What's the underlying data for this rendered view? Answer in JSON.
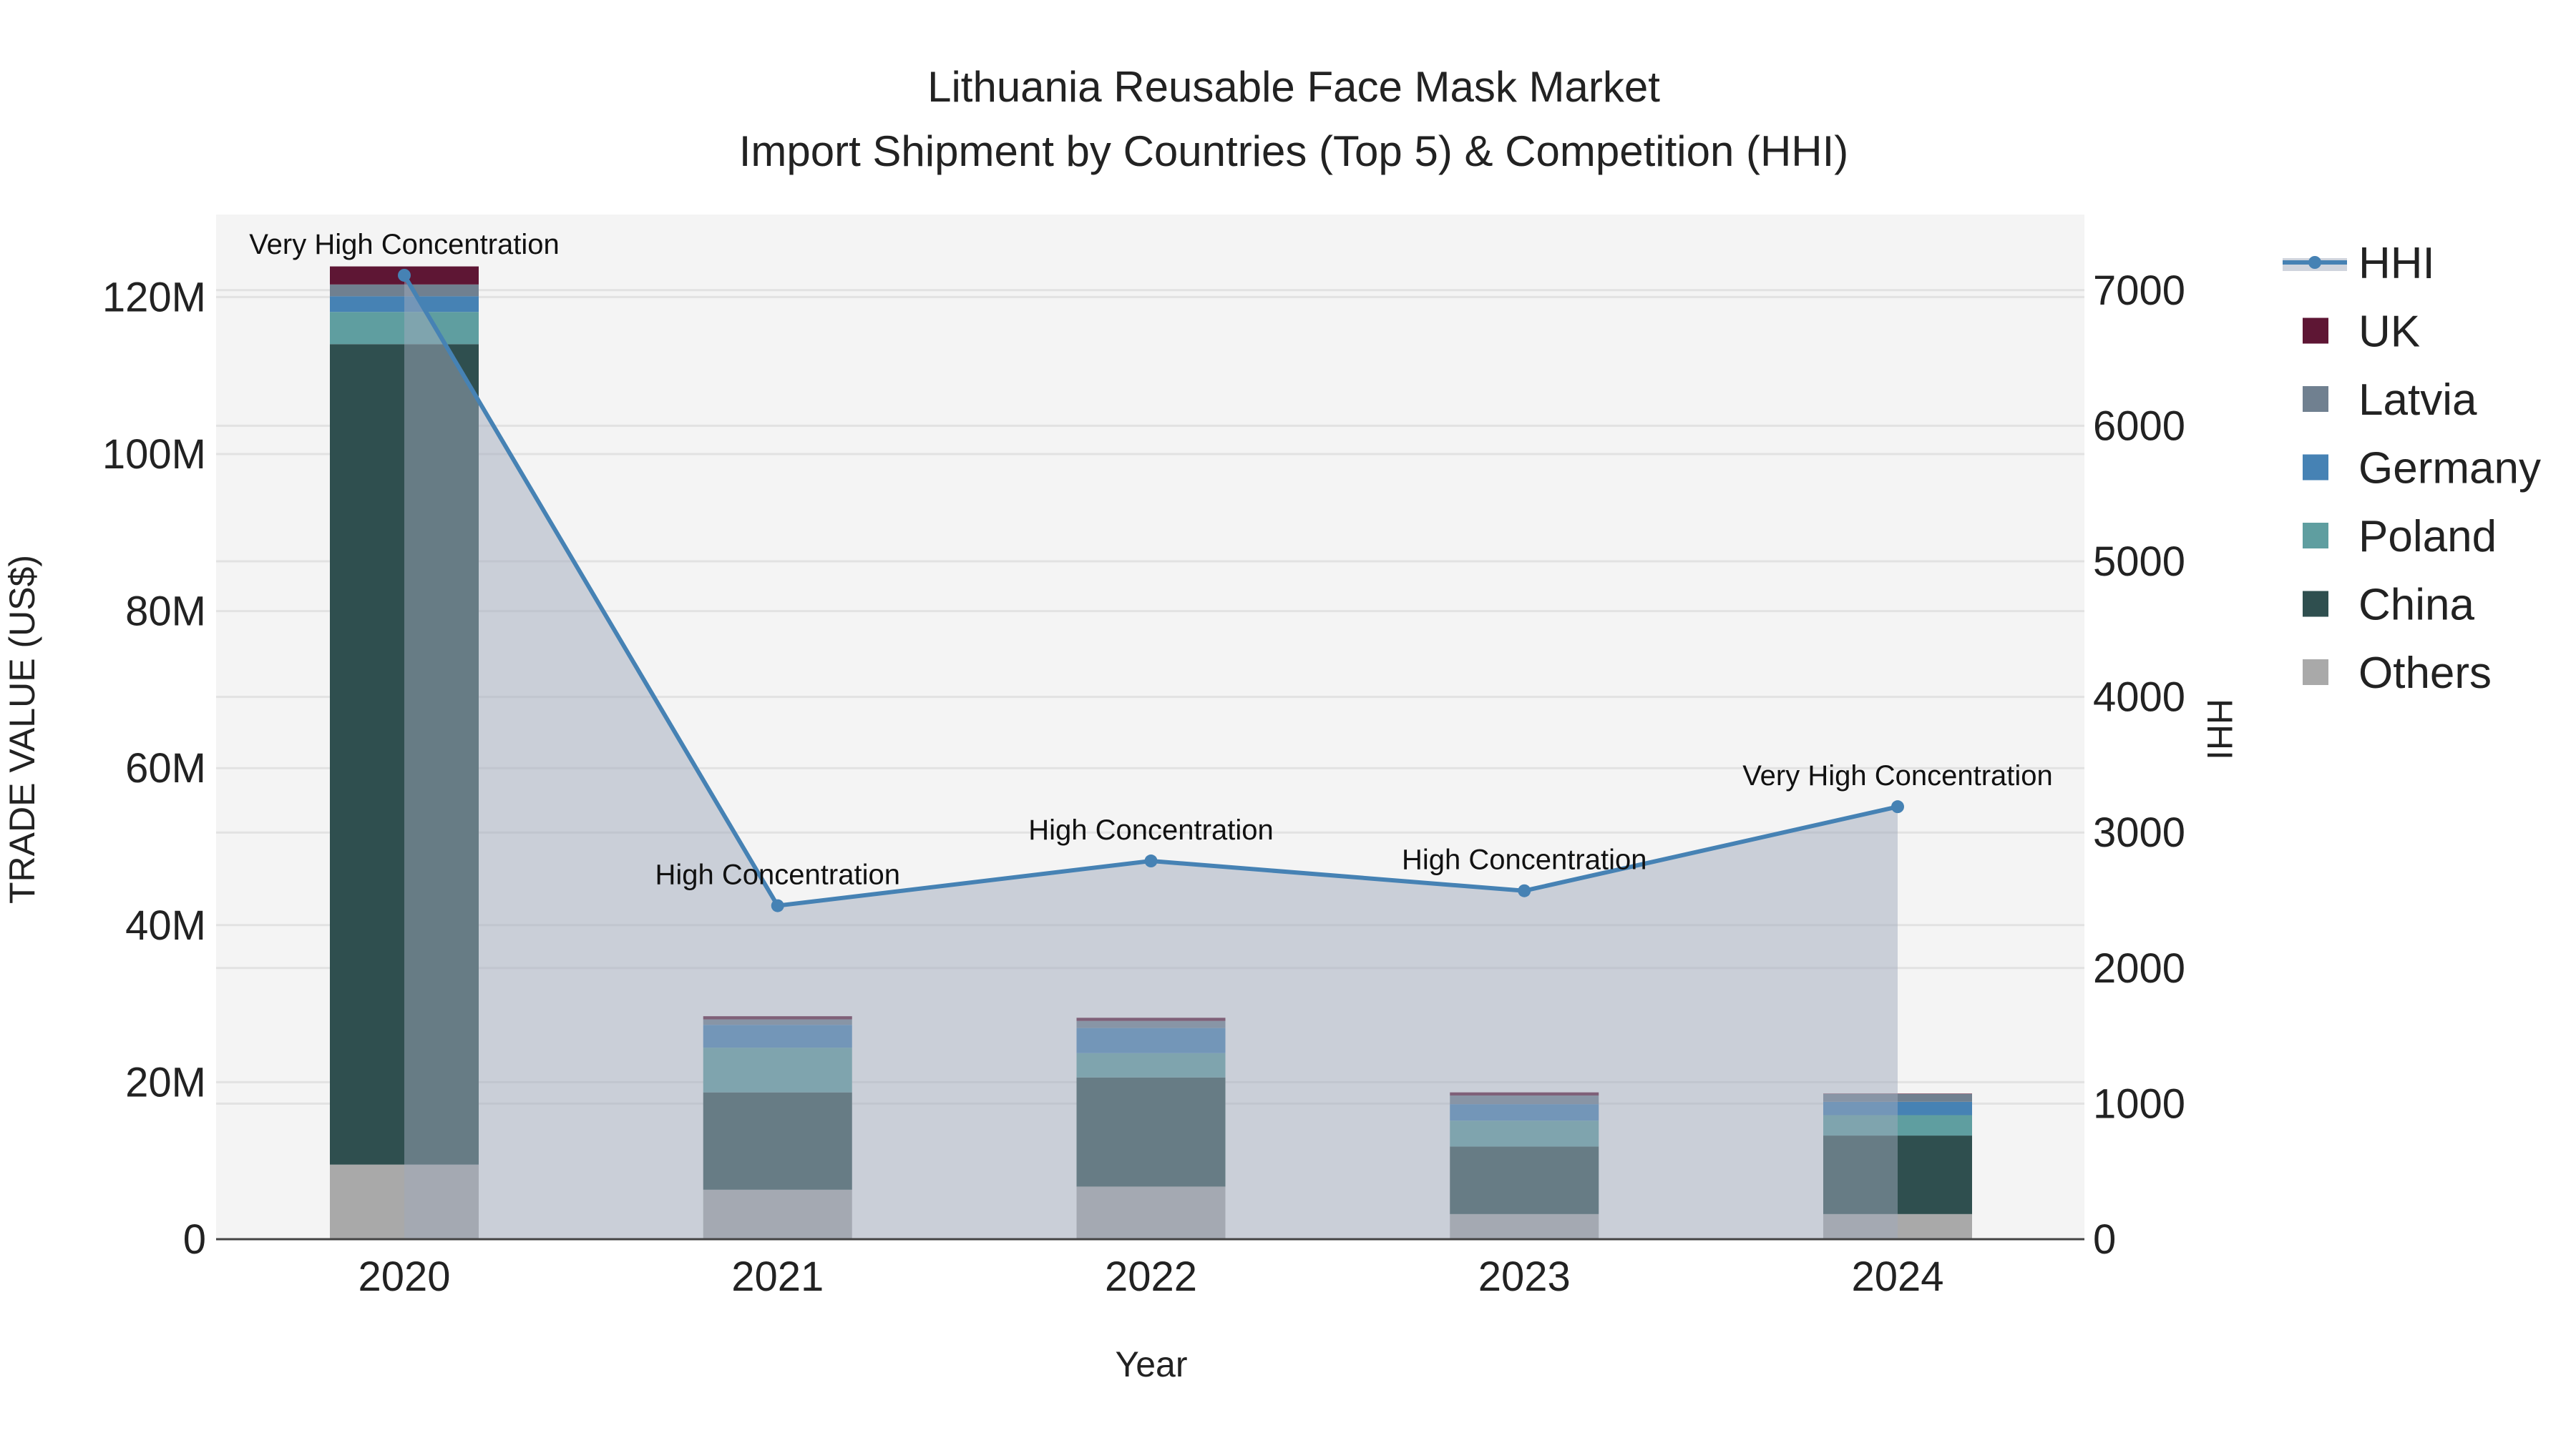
{
  "chart_data": {
    "type": "bar",
    "title_line1": "Lithuania Reusable Face Mask Market",
    "title_line2": "Import Shipment by Countries (Top 5) & Competition (HHI)",
    "xlabel": "Year",
    "ylabel": "TRADE VALUE (US$)",
    "y2label": "HHI",
    "categories": [
      "2020",
      "2021",
      "2022",
      "2023",
      "2024"
    ],
    "ylim": [
      0,
      130
    ],
    "y_unit": "M",
    "y_ticks": [
      0,
      20,
      40,
      60,
      80,
      100,
      120
    ],
    "y_tick_labels": [
      "0",
      "20M",
      "40M",
      "60M",
      "80M",
      "100M",
      "120M"
    ],
    "y2lim": [
      0,
      7550
    ],
    "y2_ticks": [
      0,
      1000,
      2000,
      3000,
      4000,
      5000,
      6000,
      7000
    ],
    "y2_tick_labels": [
      "0",
      "1000",
      "2000",
      "3000",
      "4000",
      "5000",
      "6000",
      "7000"
    ],
    "series": [
      {
        "name": "Others",
        "color": "#a9a9a9",
        "values": [
          9.5,
          6.3,
          6.7,
          3.2,
          3.2
        ]
      },
      {
        "name": "China",
        "color": "#2f4f4f",
        "values": [
          104.5,
          12.4,
          13.9,
          8.6,
          10.0
        ]
      },
      {
        "name": "Poland",
        "color": "#5f9ea0",
        "values": [
          4.1,
          5.7,
          3.1,
          3.3,
          2.6
        ]
      },
      {
        "name": "Germany",
        "color": "#4682b4",
        "values": [
          2.0,
          2.9,
          3.2,
          2.1,
          1.7
        ]
      },
      {
        "name": "Latvia",
        "color": "#708090",
        "values": [
          1.5,
          0.7,
          0.9,
          1.1,
          1.0
        ]
      },
      {
        "name": "UK",
        "color": "#5e1634",
        "values": [
          2.3,
          0.4,
          0.4,
          0.4,
          0.05
        ]
      }
    ],
    "hhi": {
      "name": "HHI",
      "color": "#4682b4",
      "values": [
        7110,
        2460,
        2790,
        2570,
        3190
      ],
      "annotations": [
        "Very High Concentration",
        "High Concentration",
        "High Concentration",
        "High Concentration",
        "Very High Concentration"
      ]
    },
    "legend": [
      "HHI",
      "UK",
      "Latvia",
      "Germany",
      "Poland",
      "China",
      "Others"
    ],
    "legend_position": "right",
    "grid": true
  }
}
